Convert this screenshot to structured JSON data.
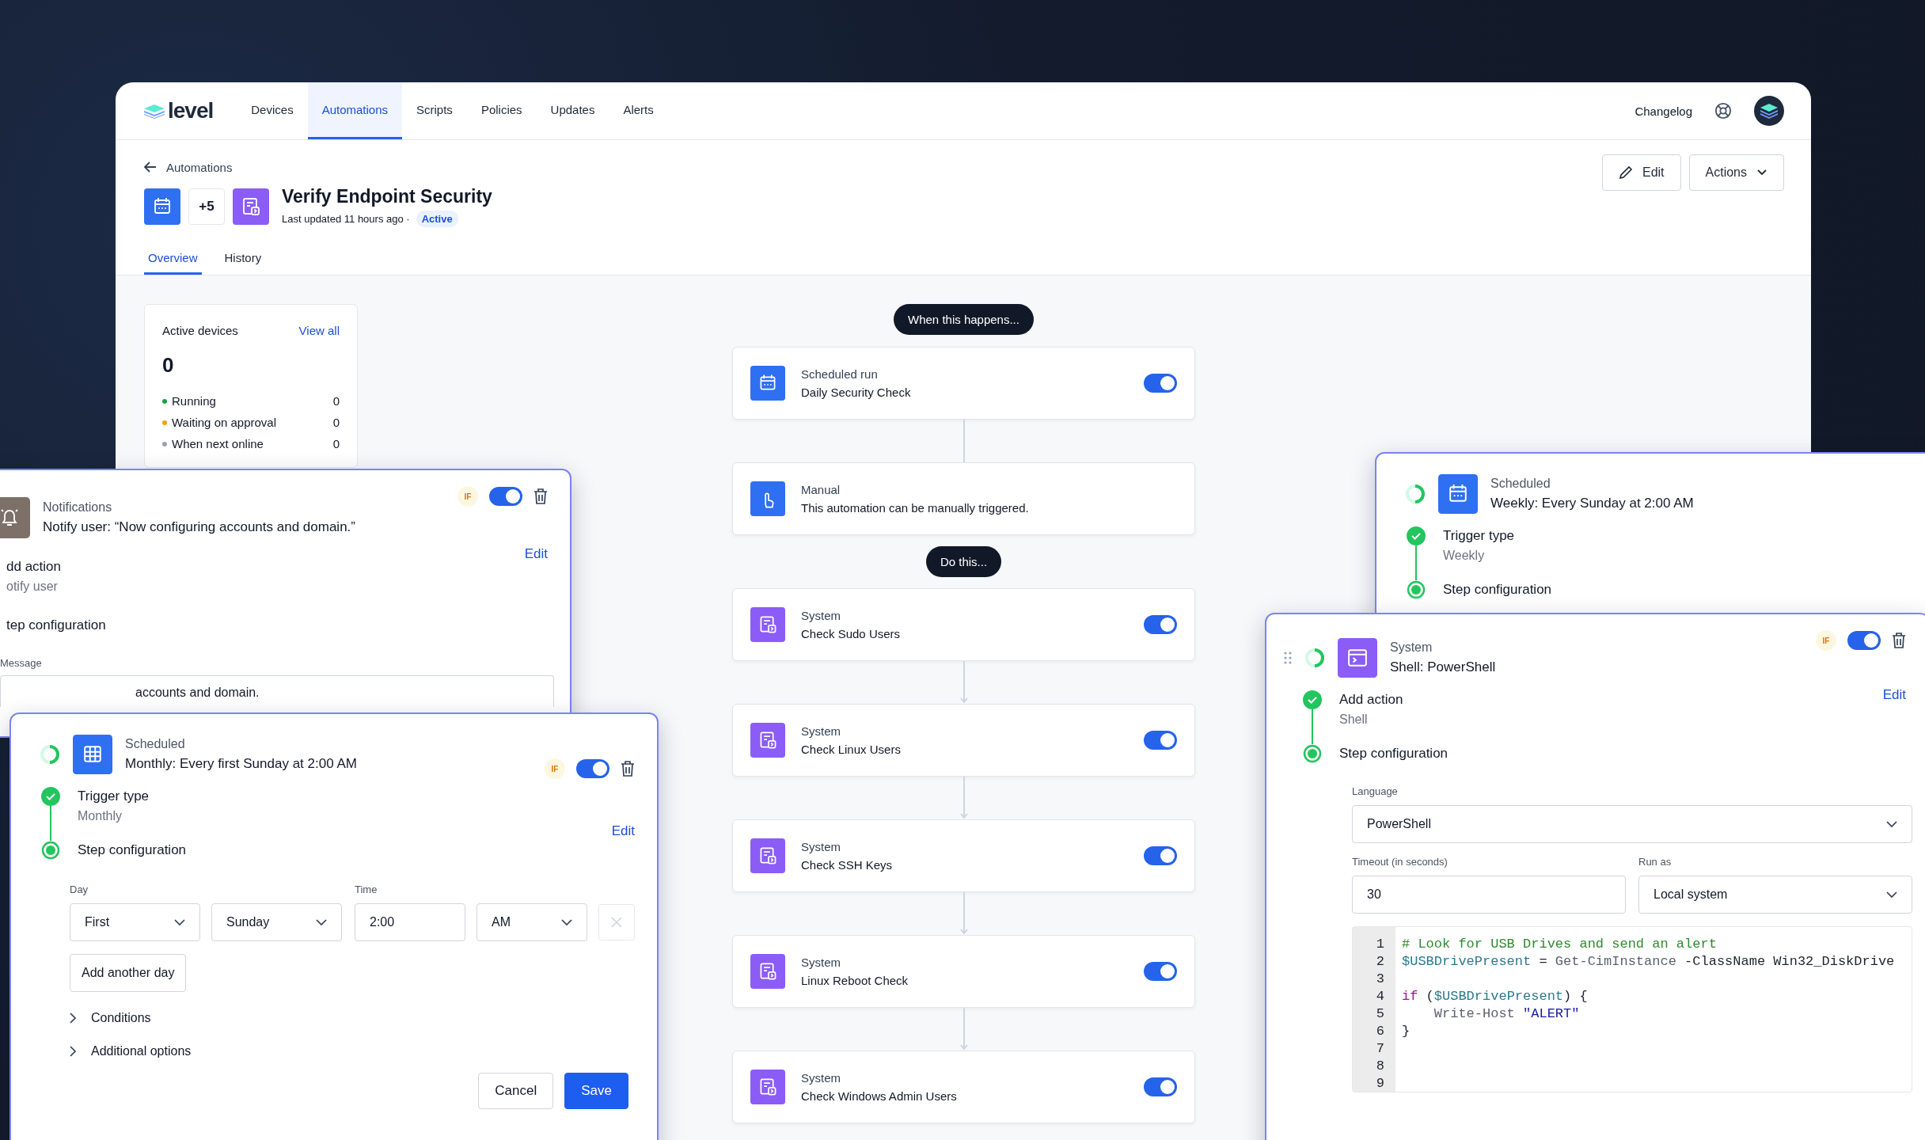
{
  "nav": {
    "logo": "level",
    "items": [
      {
        "label": "Devices",
        "selected": false
      },
      {
        "label": "Automations",
        "selected": true
      },
      {
        "label": "Scripts",
        "selected": false
      },
      {
        "label": "Policies",
        "selected": false
      },
      {
        "label": "Updates",
        "selected": false
      },
      {
        "label": "Alerts",
        "selected": false
      }
    ],
    "changelog": "Changelog"
  },
  "breadcrumb": "Automations",
  "header_actions": {
    "edit": "Edit",
    "actions": "Actions"
  },
  "automation": {
    "extra_count": "+5",
    "title": "Verify Endpoint Security",
    "updated": "Last updated 11 hours ago ·",
    "status": "Active"
  },
  "tabs": [
    {
      "label": "Overview",
      "selected": true
    },
    {
      "label": "History",
      "selected": false
    }
  ],
  "active_devices": {
    "title": "Active devices",
    "link": "View all",
    "count": "0",
    "rows": [
      {
        "label": "Running",
        "value": "0",
        "color": "#16a34a"
      },
      {
        "label": "Waiting on approval",
        "value": "0",
        "color": "#f59e0b"
      },
      {
        "label": "When next online",
        "value": "0",
        "color": "#9ca3af"
      }
    ]
  },
  "flow": {
    "trigger_heading": "When this happens...",
    "triggers": [
      {
        "kind": "schedule",
        "type": "Scheduled run",
        "name": "Daily Security Check",
        "on": true
      },
      {
        "kind": "manual",
        "type": "Manual",
        "name": "This automation can be manually triggered."
      }
    ],
    "action_heading": "Do this...",
    "actions": [
      {
        "kind": "system",
        "type": "System",
        "name": "Check Sudo Users",
        "on": true
      },
      {
        "kind": "system",
        "type": "System",
        "name": "Check Linux Users",
        "on": true
      },
      {
        "kind": "system",
        "type": "System",
        "name": "Check SSH Keys",
        "on": true
      },
      {
        "kind": "system",
        "type": "System",
        "name": "Linux Reboot Check",
        "on": true
      },
      {
        "kind": "system",
        "type": "System",
        "name": "Check Windows Admin Users",
        "on": true
      }
    ]
  },
  "notification_card": {
    "category": "Notifications",
    "title": "Notify user: “Now configuring accounts and domain.”",
    "if_badge": "IF",
    "on": true,
    "edit": "Edit",
    "steps": [
      {
        "title": "dd action",
        "value": "otify user"
      },
      {
        "title": "tep configuration"
      }
    ],
    "message_label": "Message",
    "message": "accounts and domain."
  },
  "monthly_card": {
    "category": "Scheduled",
    "title": "Monthly: Every first Sunday at 2:00 AM",
    "if_badge": "IF",
    "on": true,
    "edit": "Edit",
    "steps": [
      {
        "title": "Trigger type",
        "value": "Monthly",
        "completed": true
      },
      {
        "title": "Step configuration",
        "completed": false
      }
    ],
    "day_label": "Day",
    "week": "First",
    "weekday": "Sunday",
    "time_label": "Time",
    "time": "2:00",
    "period": "AM",
    "add_day": "Add another day",
    "sections": [
      "Conditions",
      "Additional options"
    ],
    "cancel": "Cancel",
    "save": "Save"
  },
  "weekly_card": {
    "category": "Scheduled",
    "title": "Weekly: Every Sunday at 2:00 AM",
    "steps": [
      {
        "title": "Trigger type",
        "value": "Weekly",
        "completed": true
      },
      {
        "title": "Step configuration",
        "completed": false
      }
    ]
  },
  "shell_card": {
    "category": "System",
    "title": "Shell: PowerShell",
    "if_badge": "IF",
    "on": true,
    "edit": "Edit",
    "steps": [
      {
        "title": "Add action",
        "value": "Shell",
        "completed": true
      },
      {
        "title": "Step configuration",
        "completed": false
      }
    ],
    "language_label": "Language",
    "language": "PowerShell",
    "timeout_label": "Timeout (in seconds)",
    "timeout": "30",
    "run_as_label": "Run as",
    "run_as": "Local system",
    "code": [
      {
        "number": "1",
        "tokens": [
          {
            "kind": "comment",
            "text": "# Look for USB Drives and send an alert"
          }
        ]
      },
      {
        "number": "2",
        "tokens": [
          {
            "kind": "variable",
            "text": "$USBDrivePresent"
          },
          {
            "kind": "plain",
            "text": " = "
          },
          {
            "kind": "cmdlet",
            "text": "Get-CimInstance"
          },
          {
            "kind": "plain",
            "text": " -ClassName Win32_DiskDrive"
          }
        ]
      },
      {
        "number": "3"
      },
      {
        "number": "4",
        "tokens": [
          {
            "kind": "keyword",
            "text": "if"
          },
          {
            "kind": "plain",
            "text": " ("
          },
          {
            "kind": "variable",
            "text": "$USBDrivePresent"
          },
          {
            "kind": "plain",
            "text": ") {"
          }
        ]
      },
      {
        "number": "5",
        "tokens": [
          {
            "kind": "cmdlet",
            "text": "    Write-Host"
          },
          {
            "kind": "string",
            "text": " \"ALERT\""
          }
        ]
      },
      {
        "number": "6",
        "tokens": [
          {
            "kind": "plain",
            "text": "}"
          }
        ]
      },
      {
        "number": "7"
      },
      {
        "number": "8"
      },
      {
        "number": "9"
      }
    ]
  }
}
